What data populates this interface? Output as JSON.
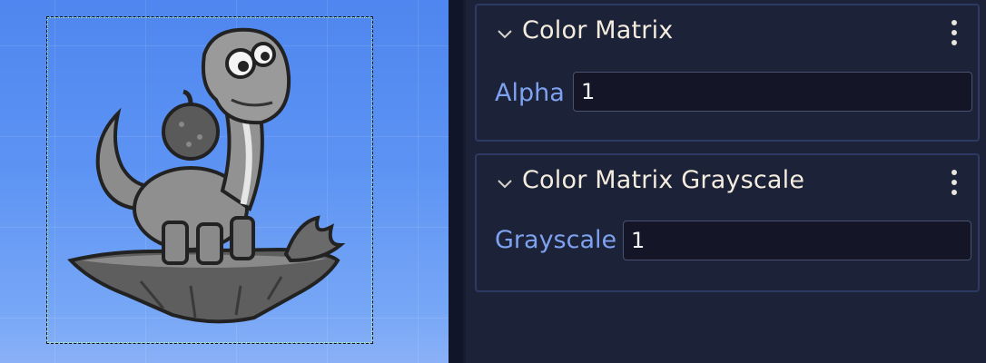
{
  "viewport": {
    "background_color": "#5c93f3",
    "sprite": "gray-dinosaur-on-rock"
  },
  "inspector": {
    "panels": [
      {
        "title": "Color Matrix",
        "expanded": true,
        "property": {
          "label": "Alpha",
          "value": "1"
        }
      },
      {
        "title": "Color Matrix Grayscale",
        "expanded": true,
        "property": {
          "label": "Grayscale",
          "value": "1"
        }
      }
    ]
  },
  "colors": {
    "title_text": "#f4ecde",
    "label_text": "#7ea2f0",
    "panel_border": "#2d3a63",
    "input_bg": "#141628"
  }
}
